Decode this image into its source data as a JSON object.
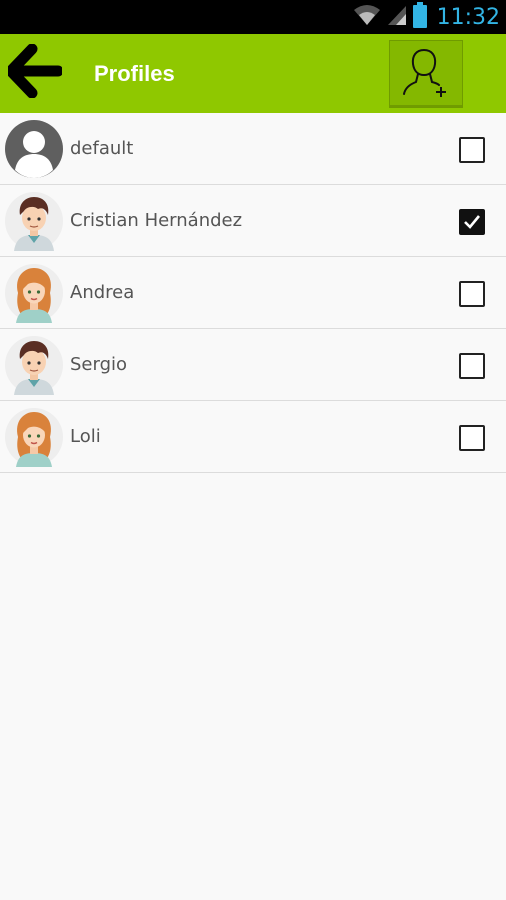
{
  "status_bar": {
    "time": "11:32",
    "icons": [
      "wifi-icon",
      "signal-icon",
      "battery-icon"
    ]
  },
  "app_bar": {
    "title": "Profiles",
    "back_icon": "arrow-left-icon",
    "add_icon": "add-user-icon",
    "background": "#8fc800"
  },
  "profiles": [
    {
      "name": "default",
      "checked": false,
      "avatar": "default-avatar-icon"
    },
    {
      "name": "Cristian Hernández",
      "checked": true,
      "avatar": "boy-avatar-icon"
    },
    {
      "name": "Andrea",
      "checked": false,
      "avatar": "girl-avatar-icon"
    },
    {
      "name": "Sergio",
      "checked": false,
      "avatar": "boy-avatar-icon"
    },
    {
      "name": "Loli",
      "checked": false,
      "avatar": "girl-avatar-icon"
    }
  ]
}
